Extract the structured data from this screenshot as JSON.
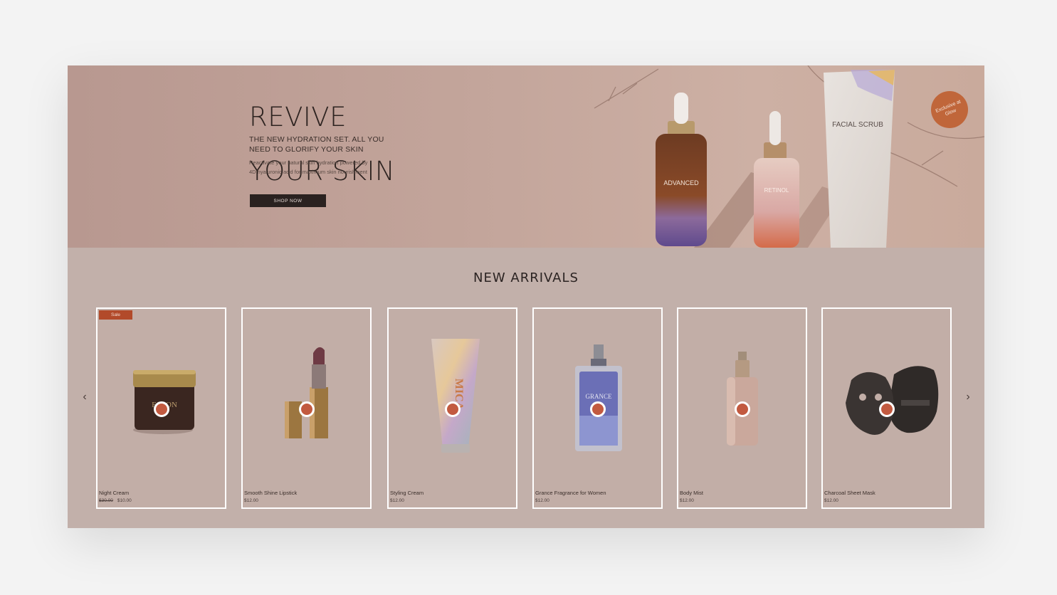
{
  "hero": {
    "title_line1": "REVIVE",
    "title_line2": "YOUR SKIN",
    "subtitle": "THE NEW HYDRATION SET. ALL YOU NEED TO GLORIFY YOUR SKIN",
    "description": "Reactivate your natural skin hydration powered by 4D hyaluronic acid for maximum skin nourishment",
    "cta_label": "SHOP NOW",
    "badge_text": "Exclusive at Glow",
    "product_labels": [
      "ADVANCED",
      "RETINOL",
      "FACIAL SCRUB"
    ]
  },
  "arrivals": {
    "title": "NEW ARRIVALS",
    "prev_icon": "chevron-left-icon",
    "next_icon": "chevron-right-icon",
    "products": [
      {
        "name": "Night Cream",
        "old_price": "$30.00",
        "price": "$10.00",
        "sale_label": "Sale",
        "brand_text": "FALON"
      },
      {
        "name": "Smooth Shine Lipstick",
        "price": "$12.00"
      },
      {
        "name": "Styling Cream",
        "price": "$12.00",
        "brand_text": "MICA"
      },
      {
        "name": "Grance Fragrance for Women",
        "price": "$12.00",
        "brand_text": "GRANCE"
      },
      {
        "name": "Body Mist",
        "price": "$12.00"
      },
      {
        "name": "Charcoal Sheet Mask",
        "price": "$12.00"
      }
    ]
  },
  "colors": {
    "hero_bg": "#c3a59b",
    "section_bg": "#c2b0aa",
    "hotspot": "#c25a40",
    "sale_tag": "#b24a2a",
    "button": "#2a2220"
  }
}
